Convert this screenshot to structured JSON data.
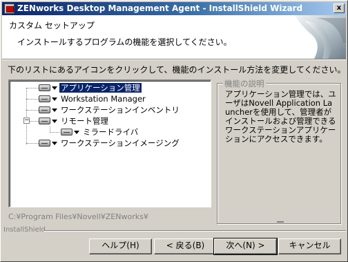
{
  "window": {
    "title": "ZENworks Desktop Management Agent - InstallShield Wizard",
    "close_glyph": "x"
  },
  "header": {
    "title": "カスタム セットアップ",
    "subtitle": "インストールするプログラムの機能を選択してください。"
  },
  "instruction": "下のリストにあるアイコンをクリックして、機能のインストール方法を変更してください。",
  "tree": {
    "items": [
      {
        "label": "アプリケーション管理",
        "selected": true
      },
      {
        "label": "Workstation Manager",
        "selected": false
      },
      {
        "label": "ワークステーションインベントリ",
        "selected": false
      },
      {
        "label": "リモート管理",
        "selected": false,
        "expander": "−"
      },
      {
        "label": "ミラードライバ",
        "selected": false
      },
      {
        "label": "ワークステーションイメージング",
        "selected": false
      }
    ]
  },
  "description": {
    "legend": "機能の説明",
    "text": "アプリケーション管理では、ユーザはNovell Application Launcherを使用して、管理者がインストールおよび管理できるワークステーションアプリケーションにアクセスできます。"
  },
  "install_path": "C:¥Program Files¥Novell¥ZENworks¥",
  "brand": "InstallShield",
  "buttons": {
    "help": "ヘルプ(H)",
    "back": "< 戻る(B)",
    "next": "次へ(N) >",
    "cancel": "キャンセル"
  },
  "colors": {
    "face": "#d4d0c8",
    "titlebar_start": "#0a246a",
    "titlebar_end": "#a6caf0",
    "selection": "#0a246a"
  }
}
